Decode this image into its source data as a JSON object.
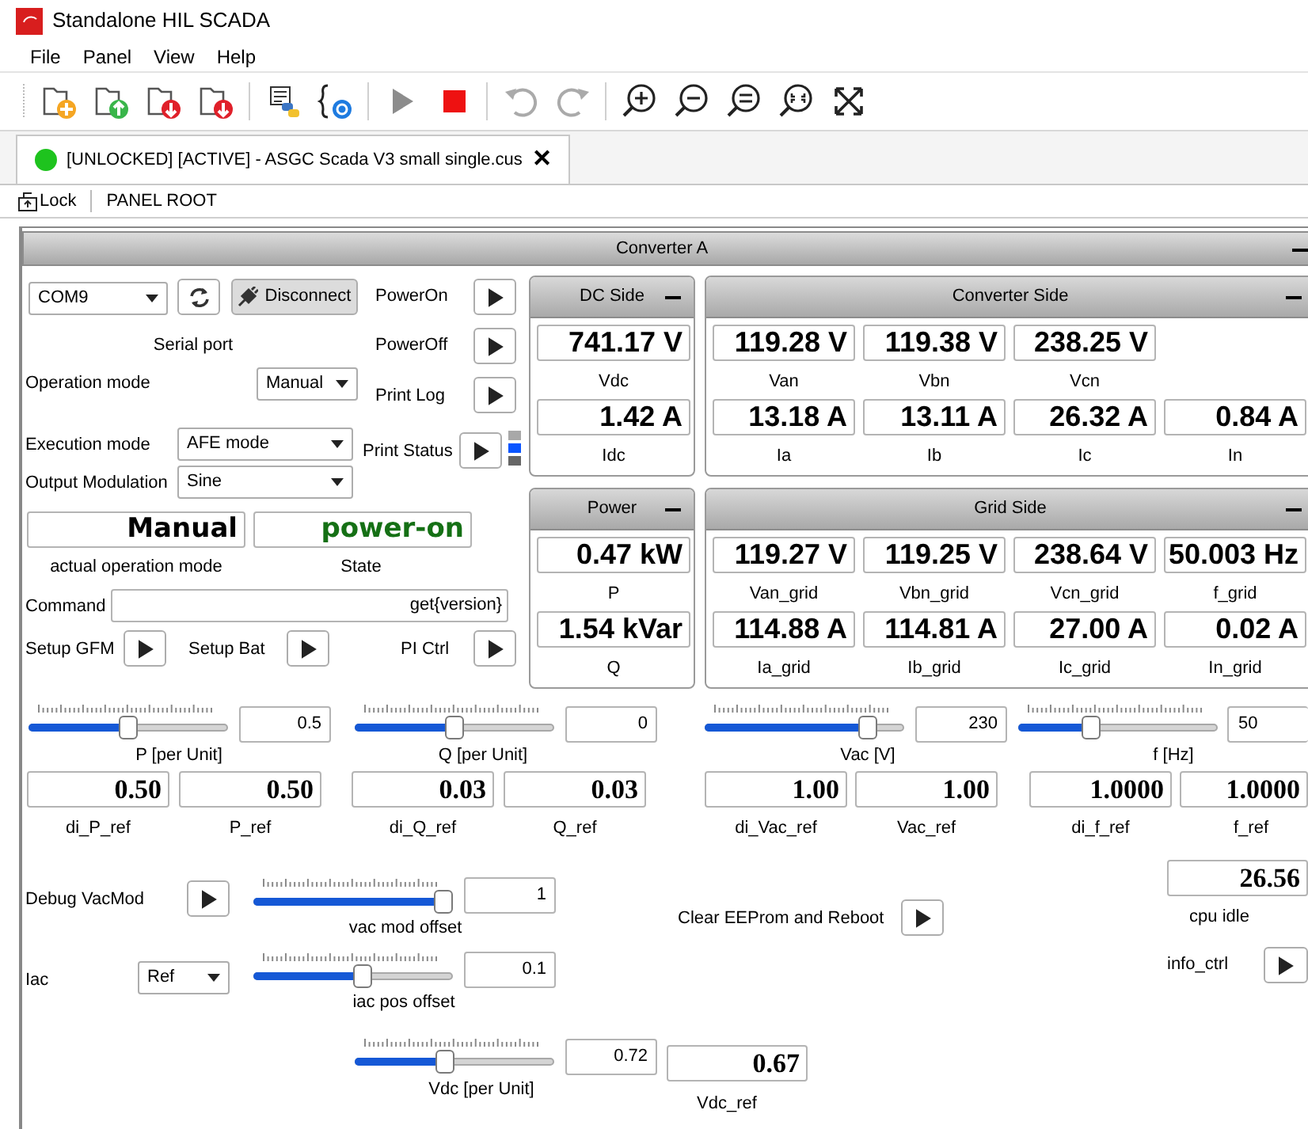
{
  "window": {
    "title": "Standalone HIL SCADA"
  },
  "menu": [
    "File",
    "Panel",
    "View",
    "Help"
  ],
  "tab": {
    "label": "[UNLOCKED] [ACTIVE] - ASGC Scada V3 small single.cus",
    "close": "✕"
  },
  "breadcrumb": {
    "lock": "Lock",
    "path": "PANEL ROOT"
  },
  "panel": {
    "title": "Converter A",
    "serial": {
      "port": "COM9",
      "disconnect": "Disconnect",
      "caption": "Serial port"
    },
    "commands": [
      {
        "label": "PowerOn"
      },
      {
        "label": "PowerOff"
      },
      {
        "label": "Print Log"
      },
      {
        "label": "Print Status"
      }
    ],
    "settings": [
      {
        "label": "Operation mode",
        "value": "Manual"
      },
      {
        "label": "Execution mode",
        "value": "AFE mode"
      },
      {
        "label": "Output Modulation",
        "value": "Sine"
      }
    ],
    "displays": [
      {
        "value": "Manual",
        "caption": "actual operation mode",
        "kind": "plain"
      },
      {
        "value": "power-on",
        "caption": "State",
        "kind": "ok"
      }
    ],
    "command": {
      "label": "Command",
      "value": "get{version}"
    },
    "actions": [
      {
        "label": "Setup GFM"
      },
      {
        "label": "Setup Bat"
      },
      {
        "label": "PI Ctrl"
      }
    ],
    "groups": [
      {
        "title": "DC Side",
        "rows": [
          [
            {
              "value": "741.17 V",
              "label": "Vdc"
            }
          ],
          [
            {
              "value": "1.42 A",
              "label": "Idc"
            }
          ]
        ]
      },
      {
        "title": "Converter Side",
        "rows": [
          [
            {
              "value": "119.28 V",
              "label": "Van"
            },
            {
              "value": "119.38 V",
              "label": "Vbn"
            },
            {
              "value": "238.25 V",
              "label": "Vcn"
            }
          ],
          [
            {
              "value": "13.18 A",
              "label": "Ia"
            },
            {
              "value": "13.11 A",
              "label": "Ib"
            },
            {
              "value": "26.32 A",
              "label": "Ic"
            },
            {
              "value": "0.84 A",
              "label": "In"
            }
          ]
        ]
      },
      {
        "title": "Power",
        "rows": [
          [
            {
              "value": "0.47 kW",
              "label": "P"
            }
          ],
          [
            {
              "value": "1.54 kVar",
              "label": "Q"
            }
          ]
        ]
      },
      {
        "title": "Grid Side",
        "rows": [
          [
            {
              "value": "119.27 V",
              "label": "Van_grid"
            },
            {
              "value": "119.25 V",
              "label": "Vbn_grid"
            },
            {
              "value": "238.64 V",
              "label": "Vcn_grid"
            },
            {
              "value": "50.003 Hz",
              "label": "f_grid"
            }
          ],
          [
            {
              "value": "114.88 A",
              "label": "Ia_grid"
            },
            {
              "value": "114.81 A",
              "label": "Ib_grid"
            },
            {
              "value": "27.00 A",
              "label": "Ic_grid"
            },
            {
              "value": "0.02 A",
              "label": "In_grid"
            }
          ]
        ]
      }
    ],
    "setpoints": [
      {
        "caption": "P [per Unit]",
        "level": 0.5,
        "value": "0.5",
        "refs": [
          {
            "value": "0.50",
            "label": "di_P_ref"
          },
          {
            "value": "0.50",
            "label": "P_ref"
          }
        ]
      },
      {
        "caption": "Q [per Unit]",
        "level": 0.5,
        "value": "0",
        "refs": [
          {
            "value": "0.03",
            "label": "di_Q_ref"
          },
          {
            "value": "0.03",
            "label": "Q_ref"
          }
        ]
      },
      {
        "caption": "Vac [V]",
        "level": 0.85,
        "value": "230",
        "refs": [
          {
            "value": "1.00",
            "label": "di_Vac_ref"
          },
          {
            "value": "1.00",
            "label": "Vac_ref"
          }
        ]
      },
      {
        "caption": "f [Hz]",
        "level": 0.35,
        "value": "50",
        "refs": [
          {
            "value": "1.0000",
            "label": "di_f_ref"
          },
          {
            "value": "1.0000",
            "label": "f_ref"
          }
        ]
      }
    ],
    "debug": {
      "label": "Debug VacMod",
      "level": 1.0,
      "value": "1",
      "caption": "vac mod offset"
    },
    "iac": {
      "label": "Iac",
      "mode": "Ref",
      "level": 0.55,
      "value": "0.1",
      "caption": "iac pos offset"
    },
    "vdc": {
      "level": 0.45,
      "value": "0.72",
      "caption": "Vdc [per Unit]",
      "ref": {
        "value": "0.67",
        "label": "Vdc_ref"
      }
    },
    "clear": {
      "label": "Clear EEProm and Reboot"
    },
    "cpu": {
      "value": "26.56",
      "label": "cpu idle"
    },
    "info": {
      "label": "info_ctrl"
    }
  }
}
